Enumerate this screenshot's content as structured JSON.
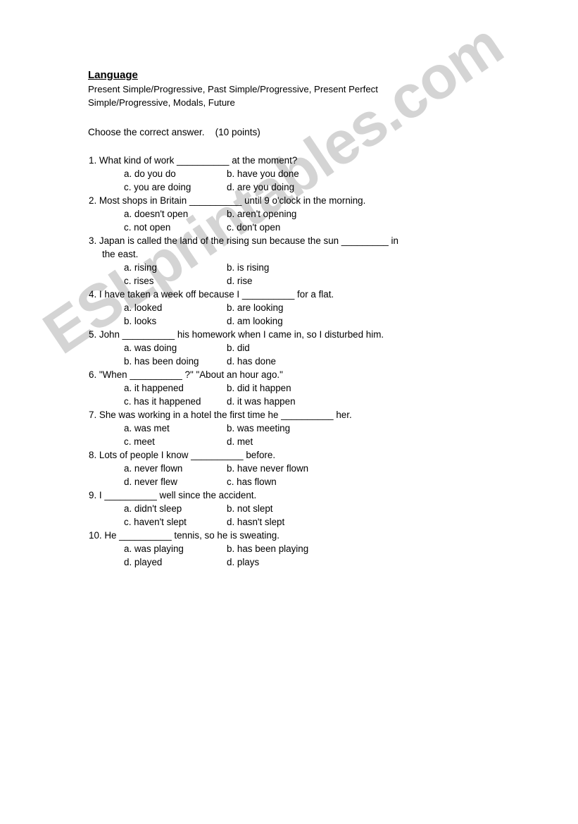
{
  "document": {
    "title": "Language",
    "subtitle": "Present Simple/Progressive, Past Simple/Progressive, Present Perfect Simple/Progressive, Modals, Future",
    "instruction": "Choose the correct answer.    (10 points)",
    "watermark": "ESLprintables.com",
    "watermark_color": "#d4d4d4",
    "page_background": "#ffffff",
    "text_color": "#000000"
  },
  "questions": [
    {
      "number": "1.",
      "stem": "1. What kind of work __________ at the moment?",
      "stem_line2": "",
      "options": [
        {
          "left": "a. do you do",
          "right": "b. have you done"
        },
        {
          "left": "c. you are doing",
          "right": "d. are you doing"
        }
      ]
    },
    {
      "number": "2.",
      "stem": "2. Most shops in Britain __________ until 9 o'clock in the morning.",
      "stem_line2": "",
      "options": [
        {
          "left": "a. doesn't open",
          "right": "b. aren't opening"
        },
        {
          "left": "c. not open",
          "right": "c. don't open"
        }
      ]
    },
    {
      "number": "3.",
      "stem": "3. Japan is called the land of the rising sun because the sun _________ in",
      "stem_line2": "the east.",
      "options": [
        {
          "left": "a. rising",
          "right": "b. is rising"
        },
        {
          "left": "c. rises",
          "right": "d. rise"
        }
      ]
    },
    {
      "number": "4.",
      "stem": "4. I have taken a week off because I __________ for a flat.",
      "stem_line2": "",
      "options": [
        {
          "left": "a. looked",
          "right": "b. are looking"
        },
        {
          "left": "b. looks",
          "right": "d. am looking"
        }
      ]
    },
    {
      "number": "5.",
      "stem": "5. John __________ his homework when I came in, so I disturbed him.",
      "stem_line2": "",
      "options": [
        {
          "left": "a. was doing",
          "right": "b. did"
        },
        {
          "left": "b. has been doing",
          "right": "d. has done"
        }
      ]
    },
    {
      "number": "6.",
      "stem": "6. \"When __________ ?\" \"About an hour ago.\"",
      "stem_line2": "",
      "options": [
        {
          "left": "a. it happened",
          "right": "b. did it happen"
        },
        {
          "left": "c. has it happened",
          "right": "d. it was happen"
        }
      ]
    },
    {
      "number": "7.",
      "stem": "7. She was working in a hotel the first time he __________ her.",
      "stem_line2": "",
      "options": [
        {
          "left": "a. was met",
          "right": "b. was meeting"
        },
        {
          "left": "c. meet",
          "right": "d. met"
        }
      ]
    },
    {
      "number": "8.",
      "stem": "8. Lots of people I know __________ before.",
      "stem_line2": "",
      "options": [
        {
          "left": "a. never flown",
          "right": "b. have never flown"
        },
        {
          "left": "d. never flew",
          "right": "c. has flown"
        }
      ]
    },
    {
      "number": "9.",
      "stem": "9. I __________ well since the accident.",
      "stem_line2": "",
      "options": [
        {
          "left": "a. didn't sleep",
          "right": "b. not slept"
        },
        {
          "left": "c. haven't slept",
          "right": "d. hasn't slept"
        }
      ]
    },
    {
      "number": "10.",
      "stem": "10. He __________ tennis, so he is sweating.",
      "stem_line2": "",
      "options": [
        {
          "left": "a. was playing",
          "right": "b. has been playing"
        },
        {
          "left": "d. played",
          "right": "d. plays"
        }
      ]
    }
  ]
}
